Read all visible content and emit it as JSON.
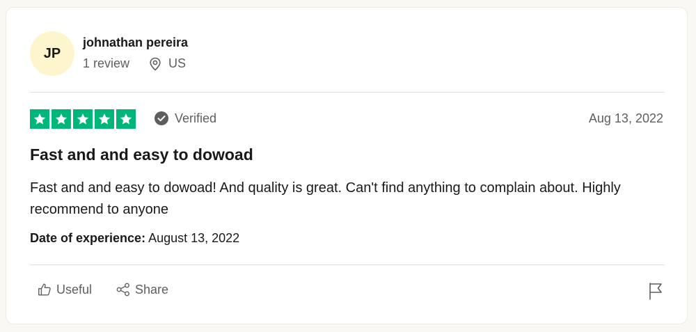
{
  "reviewer": {
    "initials": "JP",
    "name": "johnathan pereira",
    "review_count": "1 review",
    "location": "US"
  },
  "review": {
    "rating": 5,
    "verified_label": "Verified",
    "date": "Aug 13, 2022",
    "title": "Fast and and easy to dowoad",
    "body": "Fast and and easy to dowoad! And quality is great. Can't find anything to complain about. Highly recommend to anyone",
    "experience_label": "Date of experience:",
    "experience_date": "August 13, 2022"
  },
  "actions": {
    "useful_label": "Useful",
    "share_label": "Share"
  },
  "colors": {
    "star_green": "#00b67a",
    "avatar_bg": "#fdf5cd",
    "muted_text": "#5e5e5e"
  },
  "icons": [
    "location-pin-icon",
    "star-icon",
    "verified-check-icon",
    "thumbs-up-icon",
    "share-icon",
    "flag-icon"
  ]
}
